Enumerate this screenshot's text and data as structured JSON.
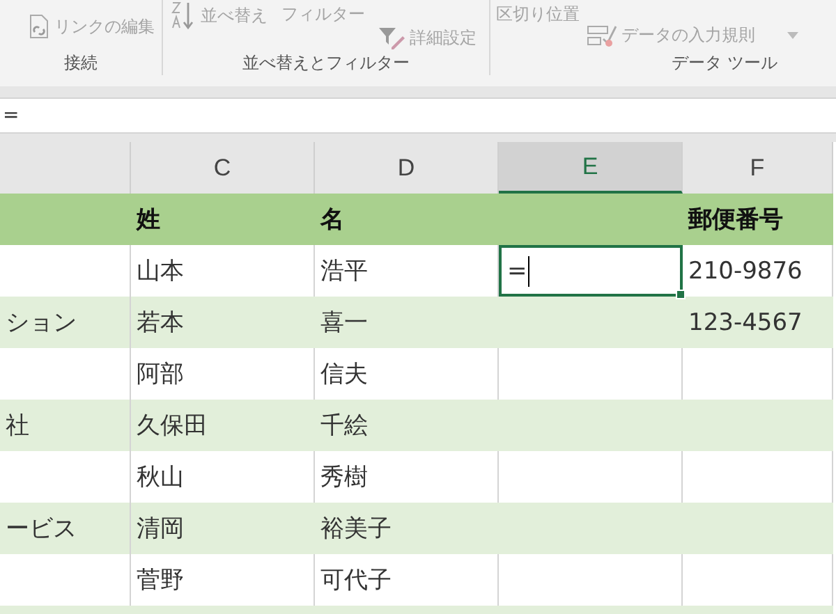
{
  "ribbon": {
    "groups": [
      {
        "label": "接続",
        "commands": [
          {
            "kind": "link",
            "label": "リンクの編集"
          }
        ]
      },
      {
        "label": "並べ替えとフィルター",
        "commands": [
          {
            "kind": "sort",
            "label": "並べ替え"
          },
          {
            "kind": "plain",
            "label": "フィルター"
          },
          {
            "kind": "advanced",
            "label": "詳細設定"
          }
        ]
      },
      {
        "label": "データ ツール",
        "commands": [
          {
            "kind": "plain",
            "label": "区切り位置"
          },
          {
            "kind": "validation",
            "label": "データの入力規則"
          }
        ]
      }
    ]
  },
  "formula_bar": {
    "value": "="
  },
  "columns": [
    {
      "selected": false
    },
    {
      "label": "C",
      "header": "姓",
      "selected": false
    },
    {
      "label": "D",
      "header": "名",
      "selected": false
    },
    {
      "label": "E",
      "selected": true
    },
    {
      "label": "F",
      "header": "郵便番号",
      "selected": false
    }
  ],
  "rows": [
    {
      "cells": [
        {
          "selected": false
        },
        {
          "text": "山本",
          "selected": false
        },
        {
          "text": "浩平",
          "selected": false
        },
        {
          "text": "=",
          "selected": true
        },
        {
          "text": "210-9876",
          "selected": false
        }
      ]
    },
    {
      "cells": [
        {
          "text": "ション",
          "selected": false
        },
        {
          "text": "若本",
          "selected": false
        },
        {
          "text": "喜一",
          "selected": false
        },
        {
          "selected": false
        },
        {
          "text": "123-4567",
          "selected": false
        }
      ]
    },
    {
      "cells": [
        {
          "selected": false
        },
        {
          "text": "阿部",
          "selected": false
        },
        {
          "text": "信夫",
          "selected": false
        },
        {
          "selected": false
        },
        {
          "selected": false
        }
      ]
    },
    {
      "cells": [
        {
          "text": "社",
          "selected": false
        },
        {
          "text": "久保田",
          "selected": false
        },
        {
          "text": "千絵",
          "selected": false
        },
        {
          "selected": false
        },
        {
          "selected": false
        }
      ]
    },
    {
      "cells": [
        {
          "selected": false
        },
        {
          "text": "秋山",
          "selected": false
        },
        {
          "text": "秀樹",
          "selected": false
        },
        {
          "selected": false
        },
        {
          "selected": false
        }
      ]
    },
    {
      "cells": [
        {
          "text": "ービス",
          "selected": false
        },
        {
          "text": "清岡",
          "selected": false
        },
        {
          "text": "裕美子",
          "selected": false
        },
        {
          "selected": false
        },
        {
          "selected": false
        }
      ]
    },
    {
      "cells": [
        {
          "selected": false
        },
        {
          "text": "菅野",
          "selected": false
        },
        {
          "text": "可代子",
          "selected": false
        },
        {
          "selected": false
        },
        {
          "selected": false
        }
      ]
    }
  ]
}
